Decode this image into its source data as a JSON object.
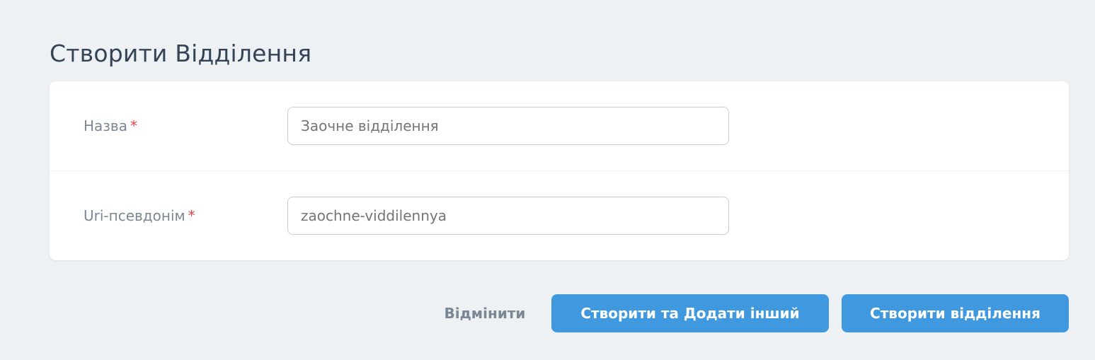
{
  "page": {
    "title": "Створити Відділення"
  },
  "form": {
    "fields": [
      {
        "label": "Назва",
        "required_mark": "*",
        "value": "",
        "placeholder": "Заочне відділення"
      },
      {
        "label": "Uri-псевдонім",
        "required_mark": "*",
        "value": "",
        "placeholder": "zaochne-viddilennya"
      }
    ]
  },
  "actions": {
    "cancel_label": "Відмінити",
    "create_and_add_label": "Створити та Додати інший",
    "create_label": "Створити відділення"
  },
  "colors": {
    "primary": "#4099de",
    "background": "#eef1f4",
    "required": "#e74444"
  }
}
